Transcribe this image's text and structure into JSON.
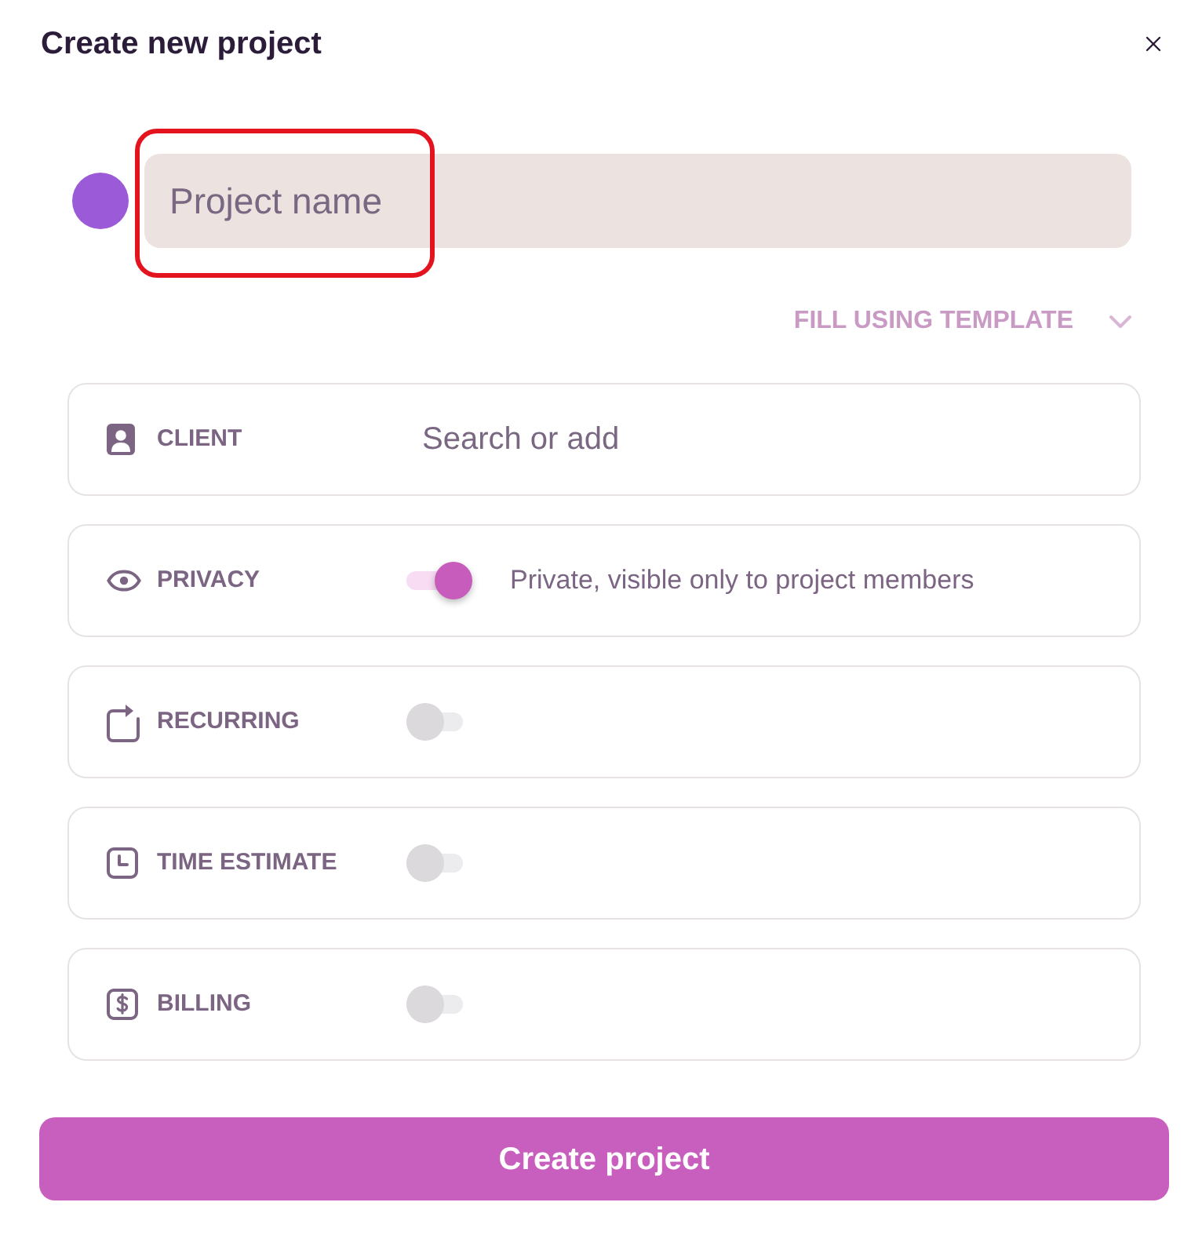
{
  "dialog": {
    "title": "Create new project"
  },
  "project": {
    "color": "#9b5bd9",
    "placeholder": "Project name",
    "highlighted": true
  },
  "template": {
    "label": "FILL USING TEMPLATE",
    "expanded": false
  },
  "fields": [
    {
      "kind": "search",
      "label": "CLIENT",
      "placeholder": "Search or add"
    },
    {
      "kind": "toggle",
      "label": "PRIVACY",
      "on": true,
      "description": "Private, visible only to project members"
    },
    {
      "kind": "toggle",
      "label": "RECURRING",
      "on": false
    },
    {
      "kind": "toggle",
      "label": "TIME ESTIMATE",
      "on": false
    },
    {
      "kind": "toggle",
      "label": "BILLING",
      "on": false
    }
  ],
  "button": {
    "label": "Create project"
  }
}
